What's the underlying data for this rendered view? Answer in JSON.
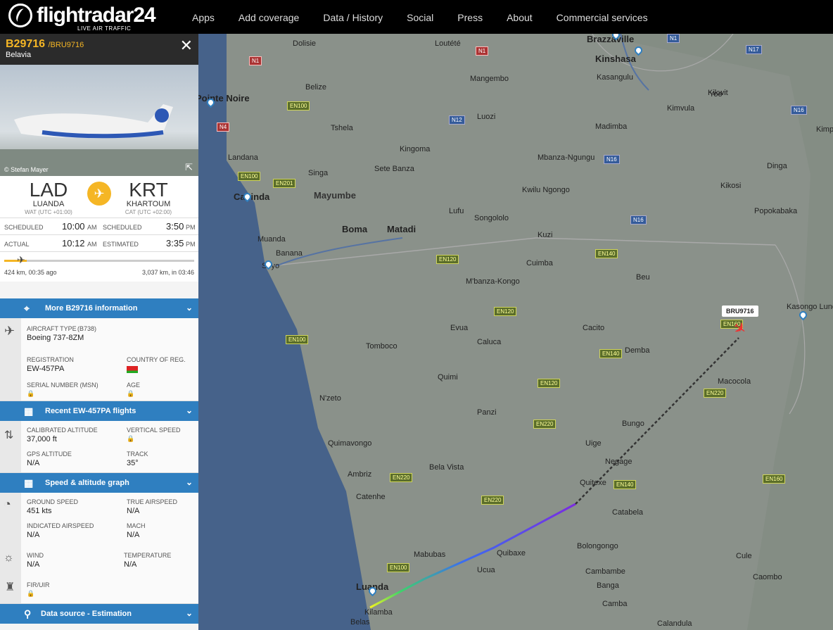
{
  "brand": {
    "name": "flightradar24",
    "tagline": "LIVE AIR TRAFFIC"
  },
  "nav": [
    "Apps",
    "Add coverage",
    "Data / History",
    "Social",
    "Press",
    "About",
    "Commercial services"
  ],
  "flight": {
    "number": "B29716",
    "callsign": "/BRU9716",
    "airline": "Belavia",
    "photo_credit": "© Stefan Mayer"
  },
  "route": {
    "origin": {
      "code": "LAD",
      "city": "LUANDA",
      "tz": "WAT (UTC +01:00)"
    },
    "destination": {
      "code": "KRT",
      "city": "KHARTOUM",
      "tz": "CAT (UTC +02:00)"
    },
    "dep_scheduled_label": "SCHEDULED",
    "dep_scheduled": "10:00",
    "dep_scheduled_ampm": "AM",
    "arr_scheduled_label": "SCHEDULED",
    "arr_scheduled": "3:50",
    "arr_scheduled_ampm": "PM",
    "dep_actual_label": "ACTUAL",
    "dep_actual": "10:12",
    "dep_actual_ampm": "AM",
    "arr_estimated_label": "ESTIMATED",
    "arr_estimated": "3:35",
    "arr_estimated_ampm": "PM",
    "progress_fraction": 0.12,
    "elapsed": "424 km, 00:35 ago",
    "remaining": "3,037 km, in 03:46"
  },
  "sections": {
    "info": "More B29716 information",
    "recent": "Recent EW-457PA flights",
    "graph": "Speed & altitude graph",
    "source": "Data source - Estimation"
  },
  "aircraft": {
    "type_label": "AIRCRAFT TYPE",
    "type_code": "(B738)",
    "type": "Boeing 737-8ZM",
    "reg_label": "REGISTRATION",
    "reg": "EW-457PA",
    "country_label": "COUNTRY OF REG.",
    "serial_label": "SERIAL NUMBER (MSN)",
    "age_label": "AGE"
  },
  "altitude": {
    "cal_label": "CALIBRATED ALTITUDE",
    "cal": "37,000 ft",
    "vs_label": "VERTICAL SPEED",
    "gps_label": "GPS ALTITUDE",
    "gps": "N/A",
    "track_label": "TRACK",
    "track": "35°"
  },
  "speed": {
    "gs_label": "GROUND SPEED",
    "gs": "451 kts",
    "tas_label": "TRUE AIRSPEED",
    "tas": "N/A",
    "ias_label": "INDICATED AIRSPEED",
    "ias": "N/A",
    "mach_label": "MACH",
    "mach": "N/A",
    "wind_label": "WIND",
    "wind": "N/A",
    "temp_label": "TEMPERATURE",
    "temp": "N/A",
    "fir_label": "FIR/UIR"
  },
  "map": {
    "aircraft_label": "BRU9716",
    "places": [
      "Brazzaville",
      "Kinshasa",
      "Pointe Noire",
      "Dolisie",
      "Loutété",
      "Mangembo",
      "Kasangulu",
      "Kikwit",
      "Kimvula",
      "Tshela",
      "Luozi",
      "Madimba",
      "Belize",
      "Kingoma",
      "Sete Banza",
      "Mbanza-Ngungu",
      "Kwilu Ngongo",
      "Landana",
      "Cabinda",
      "Singa",
      "Mayumbe",
      "Lufu",
      "Songololo",
      "Boma",
      "Matadi",
      "Muanda",
      "Banana",
      "Soyo",
      "Kuzi",
      "Cuimba",
      "M'banza-Kongo",
      "Evua",
      "Caluca",
      "Cacito",
      "Demba",
      "Tomboco",
      "Quimi",
      "N'zeto",
      "Quimavongo",
      "Bela Vista",
      "Bungo",
      "Uige",
      "Negage",
      "Quitexe",
      "Ambriz",
      "Catabela",
      "Catenhe",
      "Bolongongo",
      "Mabubas",
      "Quibaxe",
      "Cambambe",
      "Luanda",
      "Kilamba",
      "Belas",
      "Caombo",
      "Cule",
      "Macocola",
      "Kasongo Lunda",
      "Kikosi",
      "Popokabaka",
      "Yoo",
      "Kimpangu",
      "Dinga",
      "Beu",
      "Panzi",
      "Ucua",
      "Banga",
      "Calandula",
      "Camba"
    ],
    "roads": [
      "N1",
      "N1",
      "N1",
      "N4",
      "N12",
      "N16",
      "N16",
      "N16",
      "N17",
      "EN100",
      "EN100",
      "EN100",
      "EN100",
      "EN120",
      "EN120",
      "EN120",
      "EN140",
      "EN140",
      "EN140",
      "EN160",
      "EN160",
      "EN201",
      "EN220",
      "EN220",
      "EN220",
      "EN220"
    ]
  }
}
